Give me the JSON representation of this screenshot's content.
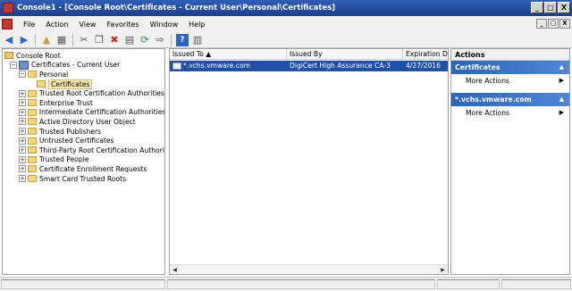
{
  "window": {
    "title": "Console1 - [Console Root\\Certificates - Current User\\Personal\\Certificates]",
    "buttons": [
      "_",
      "□",
      "X"
    ]
  },
  "menu": {
    "items": [
      "File",
      "Action",
      "View",
      "Favorites",
      "Window",
      "Help"
    ],
    "mdi_buttons": [
      "_",
      "▢",
      "X"
    ]
  },
  "toolbar": {
    "icons": [
      "back-icon",
      "forward-icon",
      "up-folder-icon",
      "show-hide-tree-icon",
      "cut-icon",
      "copy-icon",
      "delete-icon",
      "properties-icon",
      "refresh-icon",
      "export-icon",
      "help-icon",
      "show-hide-action-pane-icon"
    ]
  },
  "tree": {
    "items": [
      {
        "label": "Console Root",
        "level": 0,
        "expander": "",
        "icon": "root-folder-icon"
      },
      {
        "label": "Certificates - Current User",
        "level": 1,
        "expander": "−",
        "icon": "certificate-store-icon"
      },
      {
        "label": "Personal",
        "level": 2,
        "expander": "−",
        "icon": "folder-icon"
      },
      {
        "label": "Certificates",
        "level": 3,
        "expander": "",
        "icon": "folder-icon",
        "selected": true
      },
      {
        "label": "Trusted Root Certification Authorities",
        "level": 2,
        "expander": "+",
        "icon": "folder-icon"
      },
      {
        "label": "Enterprise Trust",
        "level": 2,
        "expander": "+",
        "icon": "folder-icon"
      },
      {
        "label": "Intermediate Certification Authorities",
        "level": 2,
        "expander": "+",
        "icon": "folder-icon"
      },
      {
        "label": "Active Directory User Object",
        "level": 2,
        "expander": "+",
        "icon": "folder-icon"
      },
      {
        "label": "Trusted Publishers",
        "level": 2,
        "expander": "+",
        "icon": "folder-icon"
      },
      {
        "label": "Untrusted Certificates",
        "level": 2,
        "expander": "+",
        "icon": "folder-icon"
      },
      {
        "label": "Third-Party Root Certification Authorities",
        "level": 2,
        "expander": "+",
        "icon": "folder-icon"
      },
      {
        "label": "Trusted People",
        "level": 2,
        "expander": "+",
        "icon": "folder-icon"
      },
      {
        "label": "Certificate Enrollment Requests",
        "level": 2,
        "expander": "+",
        "icon": "folder-icon"
      },
      {
        "label": "Smart Card Trusted Roots",
        "level": 2,
        "expander": "+",
        "icon": "folder-icon"
      }
    ]
  },
  "list": {
    "columns": [
      "Issued To  ▲",
      "Issued By",
      "Expiration Da"
    ],
    "rows": [
      {
        "issued_to": "*.vchs.vmware.com",
        "issued_by": "DigiCert High Assurance CA-3",
        "expiration": "4/27/2016"
      }
    ]
  },
  "actions": {
    "header": "Actions",
    "sections": [
      {
        "title": "Certificates",
        "items": [
          "More Actions"
        ]
      },
      {
        "title": "*.vchs.vmware.com",
        "items": [
          "More Actions"
        ]
      }
    ]
  }
}
